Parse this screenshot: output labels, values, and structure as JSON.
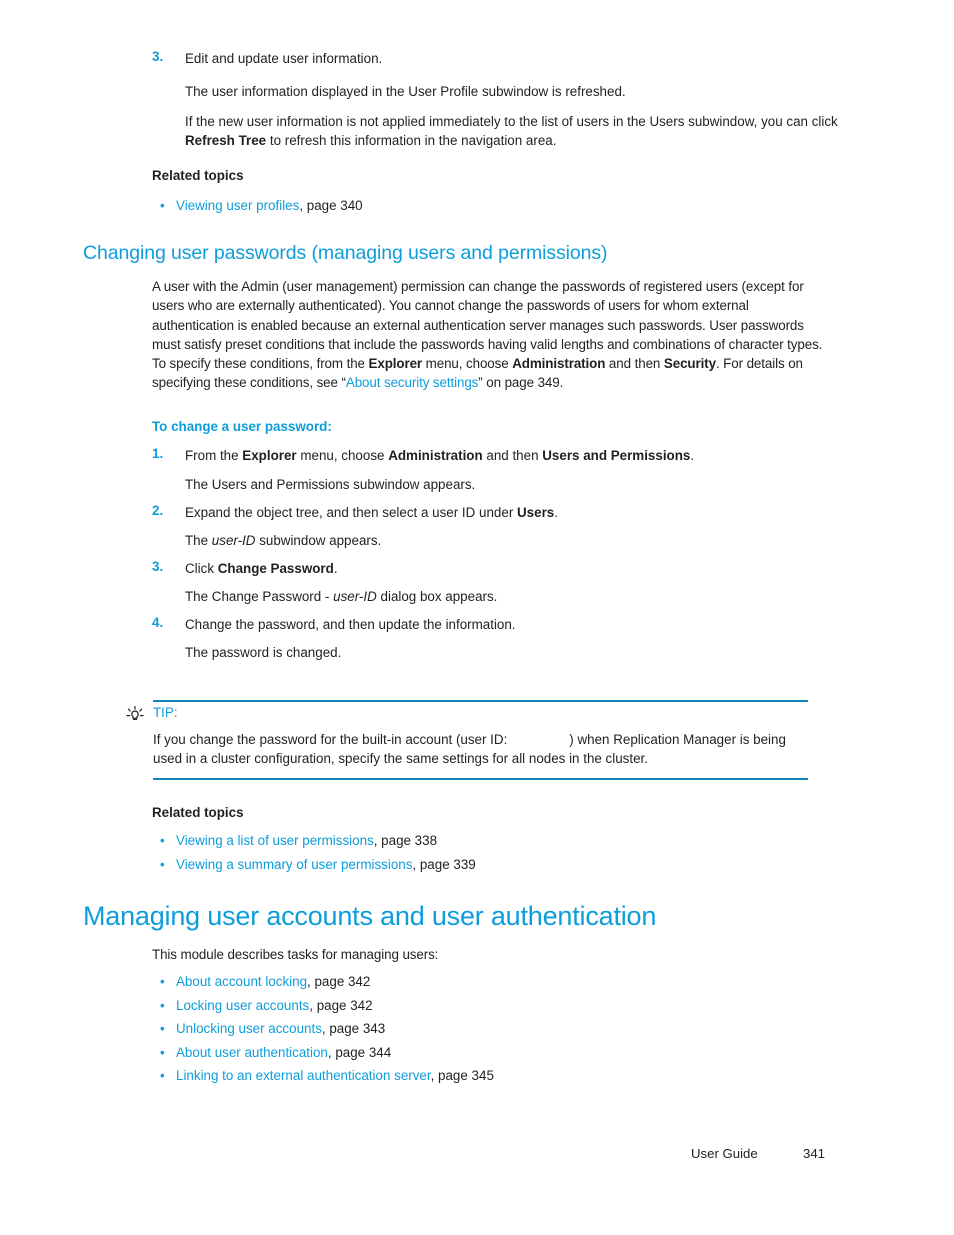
{
  "page": {
    "footer_label": "User Guide",
    "footer_page_number": "341"
  },
  "colors": {
    "accent_blue": "#0d9ddb",
    "rule_blue": "#1183b5",
    "body_black": "#231f20"
  },
  "step3_top": {
    "number": "3.",
    "text": "Edit and update user information.",
    "result": "The user information displayed in the User Profile subwindow is refreshed.",
    "note_part1": "If the new user information is not applied immediately to the list of users in the Users subwindow, you can click ",
    "note_bold": "Refresh Tree",
    "note_part2": " to refresh this information in the navigation area."
  },
  "related_topics_1": {
    "heading": "Related topics",
    "items": [
      {
        "bullet": "•",
        "link": "Viewing user profiles",
        "tail": ", page 340"
      }
    ]
  },
  "section_changing_passwords": {
    "heading": "Changing user passwords (managing users and permissions)",
    "paragraph": {
      "p1": "A user with the Admin (user management) permission can change the passwords of registered users (except for users who are externally authenticated). You cannot change the passwords of users for whom external authentication is enabled because an external authentication server manages such passwords. User passwords must satisfy preset conditions that include the passwords having valid lengths and combinations of character types. To specify these conditions, from the ",
      "b1": "Explorer",
      "p2": " menu, choose ",
      "b2": "Administration",
      "p3": " and then ",
      "b3": "Security",
      "p4": ". For details on specifying these conditions, see “",
      "link1": "About security settings",
      "p5": "” on page 349."
    },
    "procedure_heading": "To change a user password:",
    "steps": [
      {
        "number": "1.",
        "parts": [
          {
            "t": "From the ",
            "style": "plain"
          },
          {
            "t": "Explorer",
            "style": "bold"
          },
          {
            "t": " menu, choose ",
            "style": "plain"
          },
          {
            "t": "Administration",
            "style": "bold"
          },
          {
            "t": " and then ",
            "style": "plain"
          },
          {
            "t": "Users and Permissions",
            "style": "bold"
          },
          {
            "t": ".",
            "style": "plain"
          }
        ],
        "result_parts": [
          {
            "t": "The Users and Permissions subwindow appears.",
            "style": "plain"
          }
        ]
      },
      {
        "number": "2.",
        "parts": [
          {
            "t": "Expand the object tree, and then select a user ID under ",
            "style": "plain"
          },
          {
            "t": "Users",
            "style": "bold"
          },
          {
            "t": ".",
            "style": "plain"
          }
        ],
        "result_parts": [
          {
            "t": "The ",
            "style": "plain"
          },
          {
            "t": "user-ID",
            "style": "italic"
          },
          {
            "t": " subwindow appears.",
            "style": "plain"
          }
        ]
      },
      {
        "number": "3.",
        "parts": [
          {
            "t": "Click ",
            "style": "plain"
          },
          {
            "t": "Change Password",
            "style": "bold"
          },
          {
            "t": ".",
            "style": "plain"
          }
        ],
        "result_parts": [
          {
            "t": "The Change Password - ",
            "style": "plain"
          },
          {
            "t": "user-ID",
            "style": "italic"
          },
          {
            "t": " dialog box appears.",
            "style": "plain"
          }
        ]
      },
      {
        "number": "4.",
        "parts": [
          {
            "t": "Change the password, and then update the information.",
            "style": "plain"
          }
        ],
        "result_parts": [
          {
            "t": "The password is changed.",
            "style": "plain"
          }
        ]
      }
    ]
  },
  "tip": {
    "icon": "lightbulb-icon",
    "label": "TIP:",
    "text_before_blank": "If you change the password for the built-in account (user ID:",
    "blank_value": "",
    "text_after_blank": ") when Replication Manager is being used in a cluster configuration, specify the same settings for all nodes in the cluster."
  },
  "related_topics_2": {
    "heading": "Related topics",
    "items": [
      {
        "bullet": "•",
        "link": "Viewing a list of user permissions",
        "tail": ", page 338"
      },
      {
        "bullet": "•",
        "link": "Viewing a summary of user permissions",
        "tail": ", page 339"
      }
    ]
  },
  "section_managing_accounts": {
    "heading": "Managing user accounts and user authentication",
    "intro": "This module describes tasks for managing users:",
    "items": [
      {
        "bullet": "•",
        "link": "About account locking",
        "tail": ", page 342"
      },
      {
        "bullet": "•",
        "link": "Locking user accounts",
        "tail": ", page 342"
      },
      {
        "bullet": "•",
        "link": "Unlocking user accounts",
        "tail": ", page 343"
      },
      {
        "bullet": "•",
        "link": "About user authentication",
        "tail": ", page 344"
      },
      {
        "bullet": "•",
        "link": "Linking to an external authentication server",
        "tail": ", page 345"
      }
    ]
  }
}
